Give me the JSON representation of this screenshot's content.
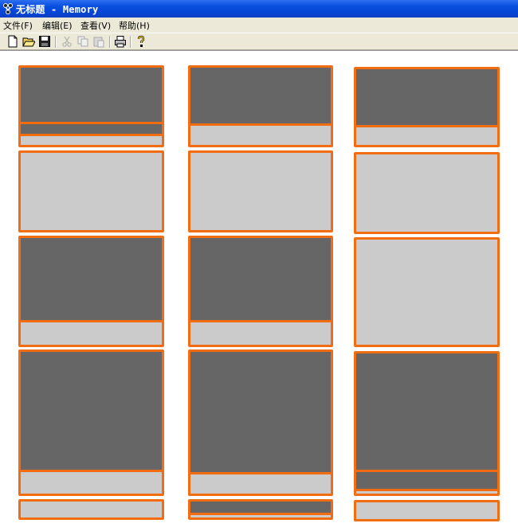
{
  "window": {
    "title": "无标题 - Memory"
  },
  "menu": [
    "文件(F)",
    "编辑(E)",
    "查看(V)",
    "帮助(H)"
  ],
  "toolbar": [
    "new-icon",
    "open-icon",
    "save-icon",
    "cut-icon",
    "copy-icon",
    "paste-icon",
    "print-icon",
    "help-icon"
  ],
  "colors": {
    "border": "#f26d12",
    "used": "#666666",
    "free": "#cbcbcb",
    "titlebar": "#0a4fe0"
  },
  "memory_blocks": [
    {
      "column": 1,
      "row": 1,
      "used_fraction": 0.7,
      "second_used_band": true
    },
    {
      "column": 2,
      "row": 1,
      "used_fraction": 0.72
    },
    {
      "column": 3,
      "row": 1,
      "used_fraction": 0.74
    },
    {
      "column": 1,
      "row": 2,
      "used_fraction": 0
    },
    {
      "column": 2,
      "row": 2,
      "used_fraction": 0
    },
    {
      "column": 3,
      "row": 2,
      "used_fraction": 0
    },
    {
      "column": 1,
      "row": 3,
      "used_fraction": 0.77
    },
    {
      "column": 2,
      "row": 3,
      "used_fraction": 0.77
    },
    {
      "column": 3,
      "row": 3,
      "used_fraction": 0
    },
    {
      "column": 1,
      "row": 4,
      "used_fraction": 0.83
    },
    {
      "column": 2,
      "row": 4,
      "used_fraction": 0.85
    },
    {
      "column": 3,
      "row": 4,
      "used_fraction": 0.83,
      "second_used_band": true
    },
    {
      "column": 1,
      "row": 5,
      "used_fraction": 0
    },
    {
      "column": 2,
      "row": 5,
      "used_fraction": 0.7
    },
    {
      "column": 3,
      "row": 5,
      "used_fraction": 0
    }
  ]
}
